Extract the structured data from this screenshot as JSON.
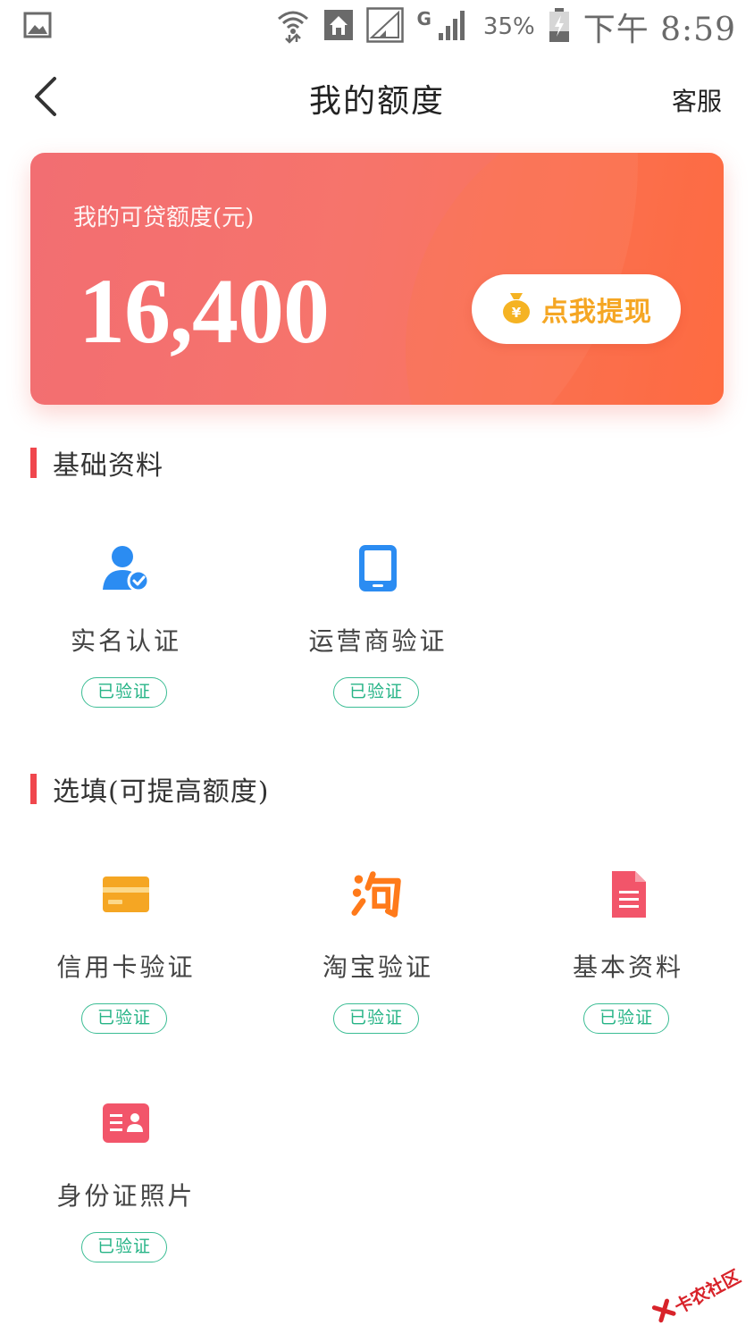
{
  "status_bar": {
    "battery_percent": "35%",
    "time": "下午 8:59",
    "network_type": "G",
    "icons": [
      "image-icon",
      "wifi-icon",
      "home-icon",
      "signal-icon",
      "signal-icon",
      "battery-icon"
    ]
  },
  "header": {
    "title": "我的额度",
    "service_label": "客服",
    "back_icon": "back-arrow-icon"
  },
  "credit": {
    "label": "我的可贷额度(元)",
    "amount": "16,400",
    "withdraw_label": "点我提现",
    "withdraw_icon": "money-bag-icon"
  },
  "sections": {
    "basic": {
      "title": "基础资料",
      "items": [
        {
          "label": "实名认证",
          "badge": "已验证",
          "icon": "user-verified-icon",
          "color": "#2b8cf2"
        },
        {
          "label": "运营商验证",
          "badge": "已验证",
          "icon": "phone-icon",
          "color": "#2b8cf2"
        }
      ]
    },
    "optional": {
      "title": "选填(可提高额度)",
      "items": [
        {
          "label": "信用卡验证",
          "badge": "已验证",
          "icon": "credit-card-icon",
          "color": "#f5a623"
        },
        {
          "label": "淘宝验证",
          "badge": "已验证",
          "icon": "taobao-icon",
          "color": "#ff7a1a"
        },
        {
          "label": "基本资料",
          "badge": "已验证",
          "icon": "document-icon",
          "color": "#f2556a"
        },
        {
          "label": "身份证照片",
          "badge": "已验证",
          "icon": "id-card-icon",
          "color": "#f2556a"
        }
      ]
    }
  },
  "colors": {
    "accent_red": "#f0474d",
    "verified_green": "#27b487",
    "withdraw_gold": "#f5a623"
  },
  "watermark": {
    "text": "卡农社区",
    "icon": "logo-icon"
  }
}
